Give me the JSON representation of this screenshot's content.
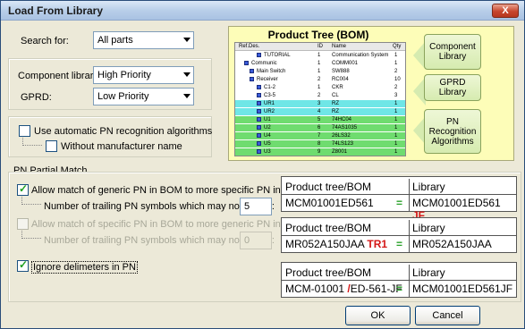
{
  "window": {
    "title": "Load From Library",
    "close_glyph": "X"
  },
  "search": {
    "label": "Search for:",
    "value": "All parts"
  },
  "component_library": {
    "label": "Component library:",
    "value": "High Priority"
  },
  "gprd": {
    "label": "GPRD:",
    "value": "Low Priority"
  },
  "auto_pn": {
    "label": "Use automatic PN recognition algorithms",
    "checked": false
  },
  "without_mfr": {
    "label": "Without manufacturer name",
    "checked": false
  },
  "partial": {
    "group_label": "PN Partial Match",
    "generic_to_specific": {
      "label": "Allow match of generic PN in BOM to more specific PN in library",
      "checked": true
    },
    "trailing1": {
      "label": "Number of trailing PN symbols which may not match:",
      "value": "5"
    },
    "specific_to_generic": {
      "label": "Allow match of specific PN in BOM to more generic PN in library",
      "checked": false
    },
    "trailing2": {
      "label": "Number of trailing PN symbols which may not match:",
      "value": "0"
    },
    "ignore_delims": {
      "label": "Ignore delimeters in PN",
      "checked": true
    }
  },
  "examples": [
    {
      "left_header": "Product tree/BOM",
      "right_header": "Library",
      "bom_main": "MCM01001ED561",
      "bom_suffix": "",
      "eq": "=",
      "lib_main": "MCM01001ED561",
      "lib_suffix": "JF"
    },
    {
      "left_header": "Product tree/BOM",
      "right_header": "Library",
      "bom_main": "MR052A150JAA",
      "bom_suffix": "TR1",
      "eq": "=",
      "lib_main": "MR052A150JAA",
      "lib_suffix": ""
    },
    {
      "left_header": "Product tree/BOM",
      "right_header": "Library",
      "bom_a": "MCM-01001",
      "bom_slash": "/",
      "bom_b": "ED-561-JF",
      "eq": "=",
      "lib_main": "MCM01001ED561JF",
      "lib_suffix": ""
    }
  ],
  "buttons": {
    "ok": "OK",
    "cancel": "Cancel"
  },
  "bom_image": {
    "title": "Product Tree (BOM)",
    "columns": [
      "Ref.Des.",
      "ID",
      "Name",
      "Qty"
    ],
    "rows": [
      {
        "ref": "TUTORIAL",
        "id": "1",
        "name": "Communication System",
        "qty": "1",
        "hl": ""
      },
      {
        "ref": "Communic",
        "id": "1",
        "name": "COMM001",
        "qty": "1",
        "hl": ""
      },
      {
        "ref": "Main Switch",
        "id": "1",
        "name": "SW888",
        "qty": "2",
        "hl": ""
      },
      {
        "ref": "Receiver",
        "id": "2",
        "name": "RC004",
        "qty": "10",
        "hl": ""
      },
      {
        "ref": "C1-2",
        "id": "1",
        "name": "CKR",
        "qty": "2",
        "hl": ""
      },
      {
        "ref": "C3-5",
        "id": "2",
        "name": "CL",
        "qty": "3",
        "hl": ""
      },
      {
        "ref": "UR1",
        "id": "3",
        "name": "RZ",
        "qty": "1",
        "hl": "cyan"
      },
      {
        "ref": "UR2",
        "id": "4",
        "name": "RZ",
        "qty": "1",
        "hl": "cyan"
      },
      {
        "ref": "U1",
        "id": "5",
        "name": "74HC04",
        "qty": "1",
        "hl": "green"
      },
      {
        "ref": "U2",
        "id": "6",
        "name": "74AS1035",
        "qty": "1",
        "hl": "green"
      },
      {
        "ref": "U4",
        "id": "7",
        "name": "26LS32",
        "qty": "1",
        "hl": "green"
      },
      {
        "ref": "U5",
        "id": "8",
        "name": "74LS123",
        "qty": "1",
        "hl": "green"
      },
      {
        "ref": "U3",
        "id": "9",
        "name": "Z8001",
        "qty": "1",
        "hl": "green"
      }
    ],
    "callouts": [
      "Component Library",
      "GPRD Library",
      "PN Recognition Algorithms"
    ]
  }
}
